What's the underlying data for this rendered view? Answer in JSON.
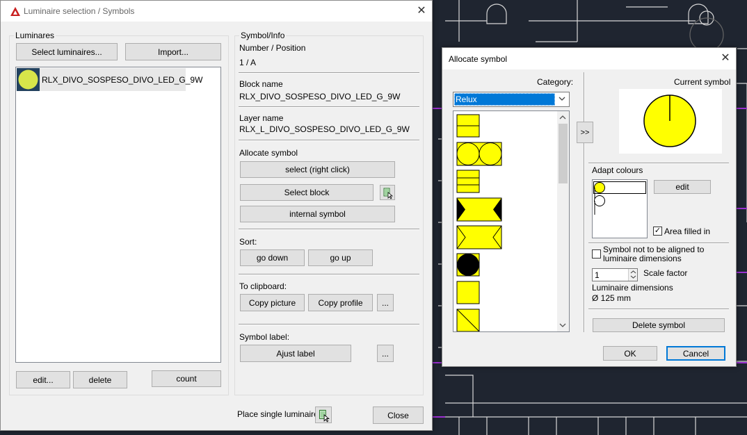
{
  "luminaire_dialog": {
    "title": "Luminaire selection / Symbols",
    "luminaires_group": "Luminares",
    "select_luminaires": "Select luminaires...",
    "import": "Import...",
    "list_items": [
      "RLX_DIVO_SOSPESO_DIVO_LED_G_9W"
    ],
    "edit": "edit...",
    "delete": "delete",
    "count": "count",
    "symbol_info_group": "Symbol/Info",
    "number_position_label": "Number / Position",
    "number_position_value": "1 / A",
    "block_name_label": "Block name",
    "block_name_value": "RLX_DIVO_SOSPESO_DIVO_LED_G_9W",
    "layer_name_label": "Layer name",
    "layer_name_value": "RLX_L_DIVO_SOSPESO_DIVO_LED_G_9W",
    "allocate_symbol_label": "Allocate symbol",
    "select_right_click": "select (right click)",
    "select_block": "Select block",
    "internal_symbol": "internal symbol",
    "sort_label": "Sort:",
    "go_down": "go down",
    "go_up": "go up",
    "clipboard_label": "To clipboard:",
    "copy_picture": "Copy picture",
    "copy_profile": "Copy profile",
    "ellipsis": "...",
    "symbol_label_label": "Symbol label:",
    "ajust_label": "Ajust label",
    "place_single_luminaire": "Place single luminaire",
    "close": "Close"
  },
  "allocate_dialog": {
    "title": "Allocate symbol",
    "category_label": "Category:",
    "category_value": "Relux",
    "transfer_button": ">>",
    "current_symbol_label": "Current symbol",
    "adapt_colours_label": "Adapt colours",
    "edit": "edit",
    "area_filled_in": "Area filled in",
    "area_filled_checked": true,
    "not_aligned_label": "Symbol not to be aligned to luminaire dimensions",
    "not_aligned_checked": false,
    "scale_value": "1",
    "scale_factor_label": "Scale factor",
    "luminaire_dimensions_label": "Luminaire dimensions",
    "luminaire_dimensions_value": "Ø 125 mm",
    "delete_symbol": "Delete symbol",
    "ok": "OK",
    "cancel": "Cancel"
  },
  "colors": {
    "symbol_yellow": "#ffff00",
    "accent_blue": "#0078d7",
    "autocad_red": "#c81e1e",
    "cad_background": "#1f2530"
  }
}
